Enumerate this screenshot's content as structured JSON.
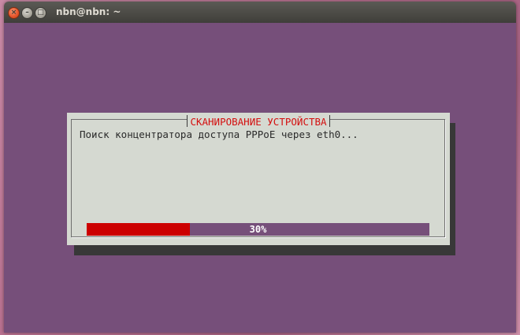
{
  "window": {
    "title": "nbn@nbn: ~",
    "close_icon": "close-icon",
    "minimize_icon": "minimize-icon",
    "maximize_icon": "maximize-icon"
  },
  "dialog": {
    "title": "СКАНИРОВАНИЕ УСТРОЙСТВА",
    "message": "Поиск концентратора доступа PPPoE через eth0...",
    "progress": {
      "value_percent": 30,
      "label": "30%"
    }
  },
  "colors": {
    "terminal_background": "#764f7a",
    "dialog_background": "#d5d9d1",
    "title_color": "#d40f0f",
    "progress_fill": "#cc0000",
    "progress_track": "#764f7a"
  }
}
